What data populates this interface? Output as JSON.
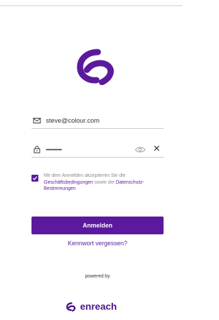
{
  "login": {
    "email_value": "steve@colour.com",
    "password_value": "••••••••••",
    "consent": {
      "checked": true,
      "prefix": "Mit dem Anmelden akzeptieren Sie die",
      "terms_link": "Geschäftsbedingungen",
      "middle": "sowie die",
      "privacy_link": "Datenschutz-Bestimmungen"
    },
    "submit_label": "Anmelden",
    "forgot_label": "Kennwort vergessen?"
  },
  "footer": {
    "powered_by": "powered by",
    "brand_name": "enreach"
  },
  "icons": {
    "email": "envelope-icon",
    "password": "lock-icon",
    "visibility": "eye-icon",
    "clear": "close-icon",
    "logo": "colour-logo-icon"
  },
  "colors": {
    "brand": "#5b1a9e",
    "brand_dark": "#4b1587"
  }
}
